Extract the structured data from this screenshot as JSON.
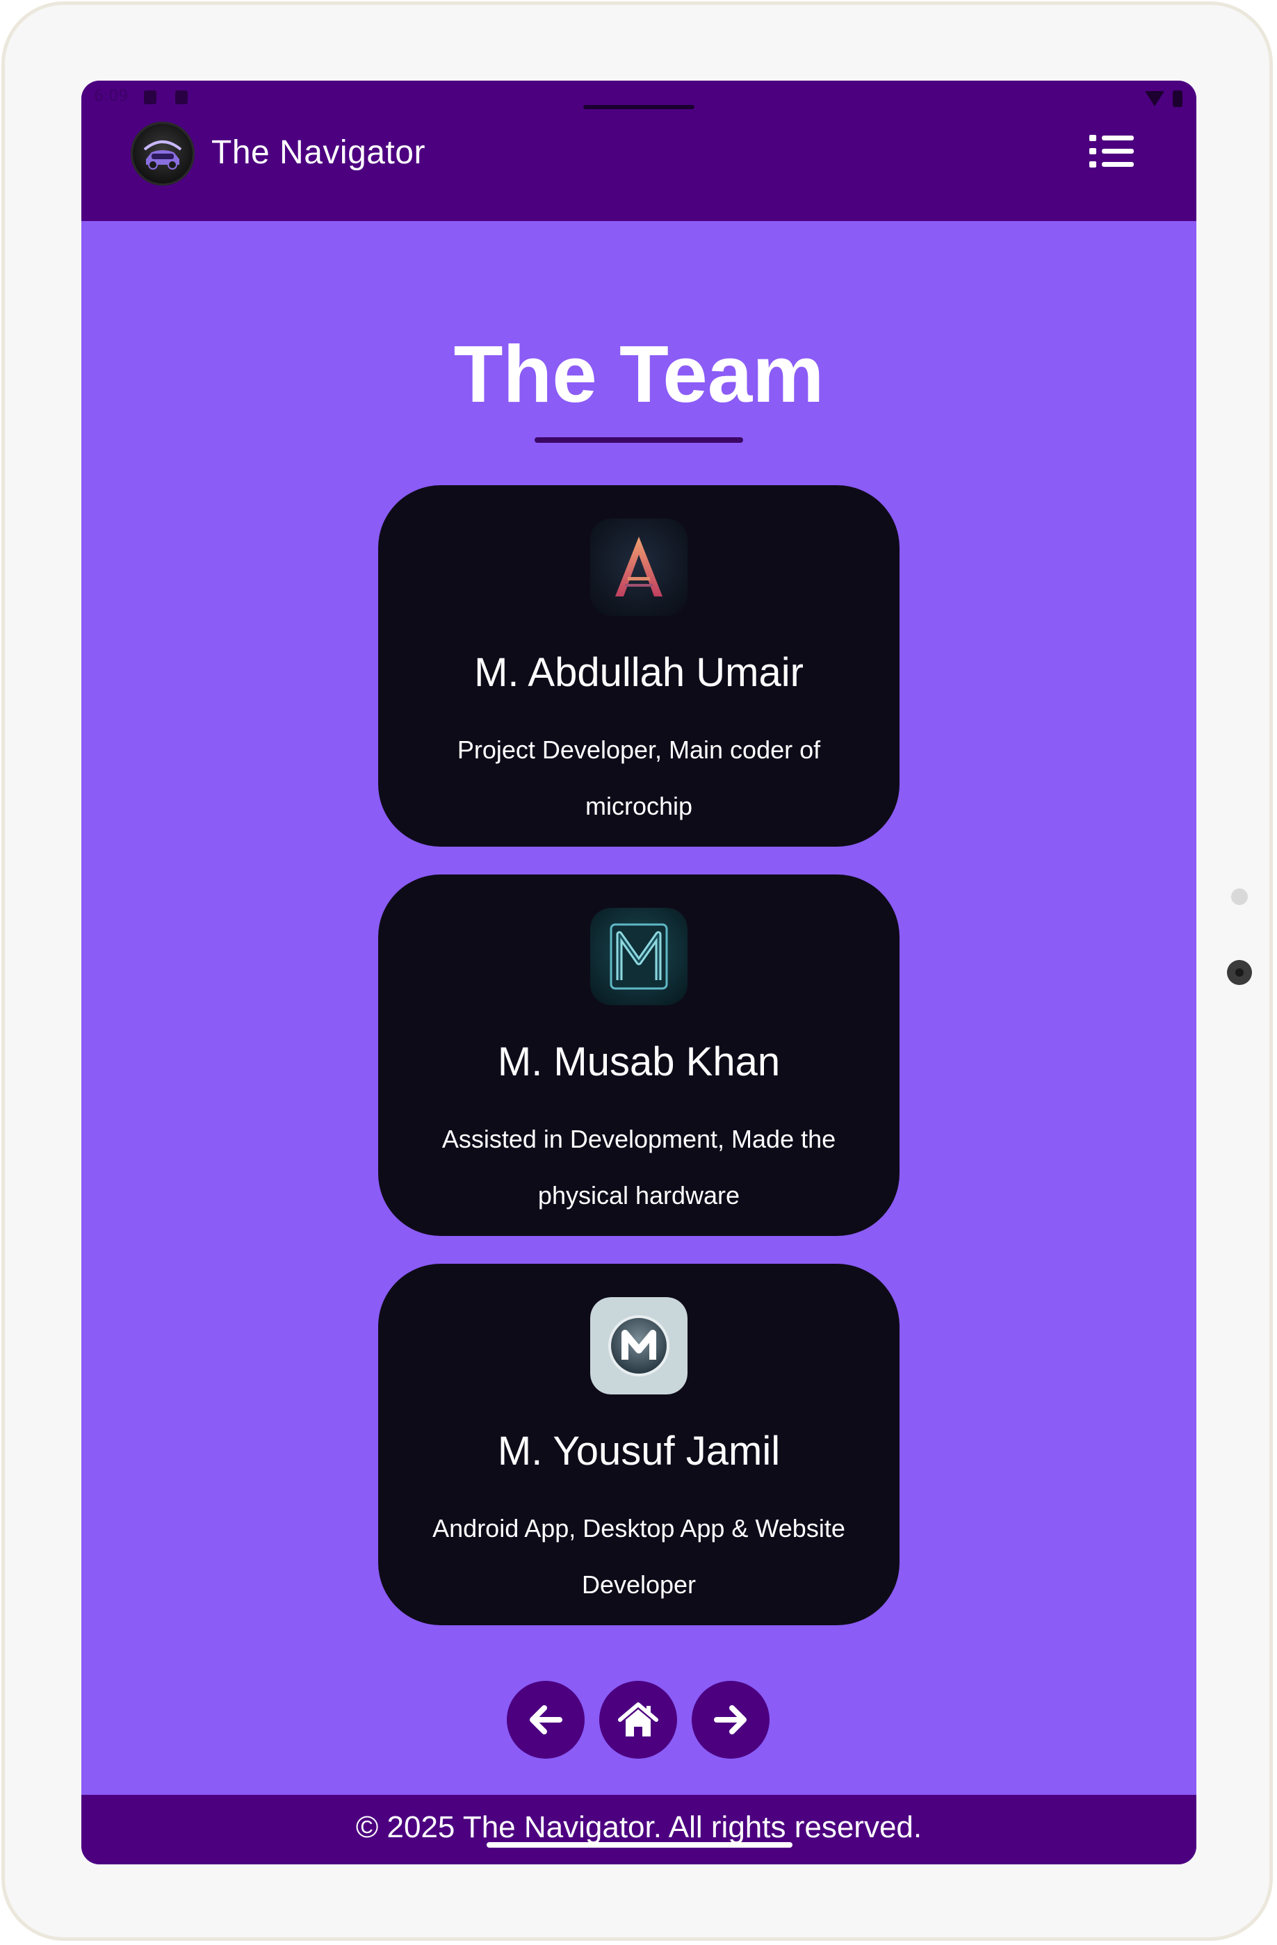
{
  "status_bar": {
    "time": "6:09"
  },
  "header": {
    "brand": "The Navigator",
    "logo_icon": "car-logo-icon",
    "menu_icon": "list-menu-icon"
  },
  "main": {
    "title": "The Team",
    "members": [
      {
        "name": "M. Abdullah Umair",
        "role": "Project Developer, Main coder of microchip",
        "avatar_icon": "letter-a-avatar"
      },
      {
        "name": "M. Musab Khan",
        "role": "Assisted in Development, Made the physical hardware",
        "avatar_icon": "letter-m-teal-avatar"
      },
      {
        "name": "M. Yousuf Jamil",
        "role": "Android App, Desktop App & Website Developer",
        "avatar_icon": "letter-m-silver-avatar"
      }
    ]
  },
  "nav_buttons": [
    {
      "icon": "arrow-left-icon"
    },
    {
      "icon": "home-icon"
    },
    {
      "icon": "arrow-right-icon"
    }
  ],
  "footer": {
    "text": "© 2025 The Navigator. All rights reserved."
  },
  "colors": {
    "header_bg": "#4c0080",
    "page_bg": "#8b5cf6",
    "card_bg": "#0e0b19",
    "accent": "#3b0764"
  }
}
